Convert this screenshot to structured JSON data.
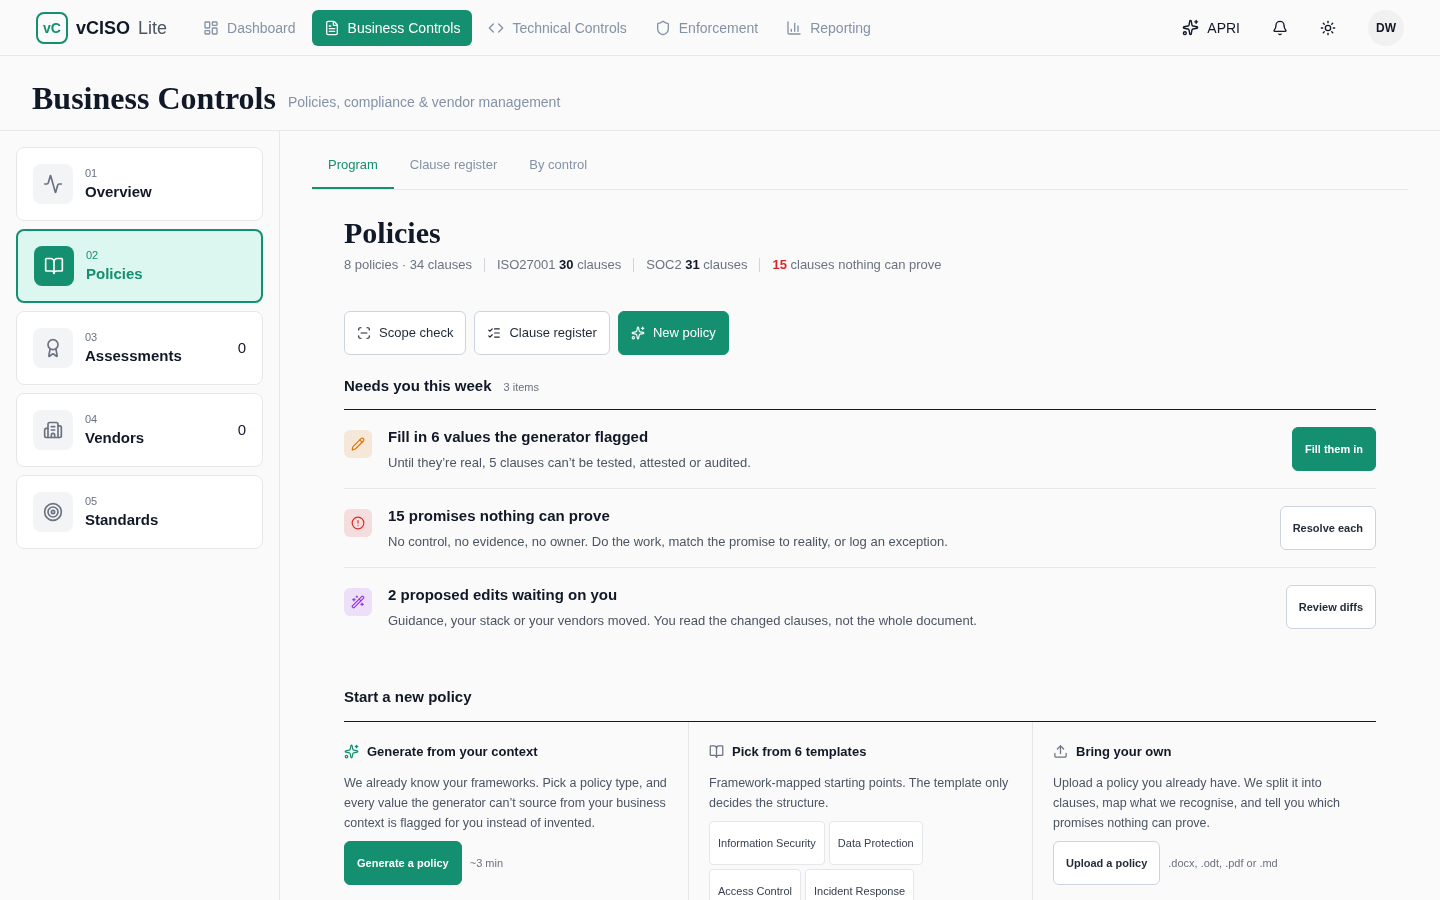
{
  "brand": {
    "logo": "vC",
    "name": "vCISO",
    "suffix": "Lite"
  },
  "nav": [
    {
      "label": "Dashboard",
      "selected": false
    },
    {
      "label": "Business Controls",
      "selected": true
    },
    {
      "label": "Technical Controls",
      "selected": false
    },
    {
      "label": "Enforcement",
      "selected": false
    },
    {
      "label": "Reporting",
      "selected": false
    }
  ],
  "header_actions": {
    "assistant": "APRI",
    "avatar": "DW"
  },
  "page": {
    "title": "Business Controls",
    "subtitle": "Policies, compliance & vendor management"
  },
  "sidebar": {
    "items": [
      {
        "number": "01",
        "label": "Overview",
        "selected": false
      },
      {
        "number": "02",
        "label": "Policies",
        "selected": true
      },
      {
        "number": "03",
        "label": "Assessments",
        "count": "0",
        "selected": false
      },
      {
        "number": "04",
        "label": "Vendors",
        "count": "0",
        "selected": false
      },
      {
        "number": "05",
        "label": "Standards",
        "selected": false
      }
    ]
  },
  "tabs": [
    {
      "label": "Program",
      "selected": true
    },
    {
      "label": "Clause register",
      "selected": false
    },
    {
      "label": "By control",
      "selected": false
    }
  ],
  "section": {
    "title": "Policies",
    "stats": [
      {
        "kind": "plain",
        "text": "8 policies · 34 clauses"
      },
      {
        "kind": "plain",
        "text": "ISO27001 **30** clauses"
      },
      {
        "kind": "plain",
        "text": "SOC2 **31** clauses"
      },
      {
        "kind": "alert",
        "text": "**15** clauses nothing can prove"
      }
    ],
    "actions": [
      {
        "label": "Scope check",
        "kind": "outline"
      },
      {
        "label": "Clause register",
        "kind": "outline"
      },
      {
        "label": "New policy",
        "kind": "primary"
      }
    ]
  },
  "needs": {
    "title": "Needs you this week",
    "count": "3 items",
    "items": [
      {
        "title": "Fill in 6 values the generator flagged",
        "description": "Until they’re real, 5 clauses can’t be tested, attested or audited.",
        "color": "#d97706",
        "action": {
          "label": "Fill them in",
          "kind": "primary"
        }
      },
      {
        "title": "15 promises nothing can prove",
        "description": "No control, no evidence, no owner. Do the work, match the promise to reality, or log an exception.",
        "color": "#dc2626",
        "action": {
          "label": "Resolve each",
          "kind": "outline"
        }
      },
      {
        "title": "2 proposed edits waiting on you",
        "description": "Guidance, your stack or your vendors moved. You read the changed clauses, not the whole document.",
        "color": "#9333ea",
        "action": {
          "label": "Review diffs",
          "kind": "outline"
        }
      }
    ]
  },
  "start": {
    "title": "Start a new policy",
    "options": [
      {
        "title": "Generate from your context",
        "description": "We already know your frameworks. Pick a policy type, and every value the generator can’t source from your business context is flagged for you instead of invented.",
        "button": {
          "label": "Generate a policy",
          "kind": "primary"
        },
        "note": "~3 min"
      },
      {
        "title": "Pick from 6 templates",
        "description": "Framework-mapped starting points. The template only decides the structure.",
        "templates": [
          "Information Security",
          "Data Protection",
          "Access Control",
          "Incident Response"
        ]
      },
      {
        "title": "Bring your own",
        "description": "Upload a policy you already have. We split it into clauses, map what we recognise, and tell you which promises nothing can prove.",
        "button": {
          "label": "Upload a policy",
          "kind": "outline"
        },
        "note": ".docx, .odt, .pdf or .md"
      }
    ]
  }
}
